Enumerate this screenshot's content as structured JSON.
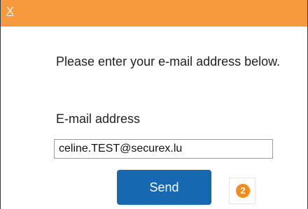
{
  "dialog": {
    "close_label": "X",
    "instructions": "Please enter your e-mail address below.",
    "email_label": "E-mail address",
    "email_value": "celine.TEST@securex.lu",
    "send_label": "Send",
    "step_number": "2"
  },
  "colors": {
    "titlebar": "#f79a3e",
    "send_button": "#1668b0",
    "step_badge": "#f28c1a"
  }
}
